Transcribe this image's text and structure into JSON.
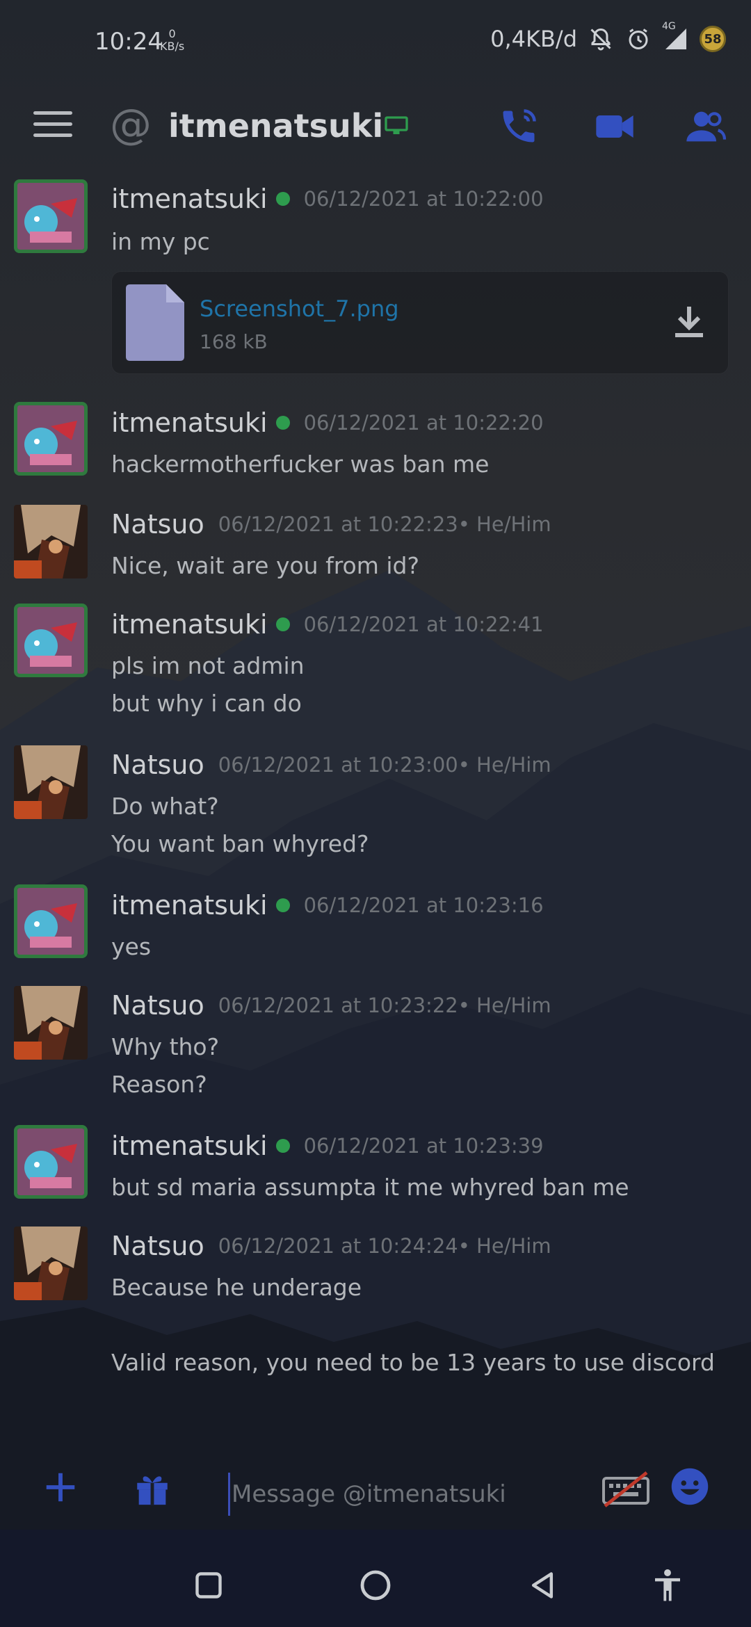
{
  "status_bar": {
    "time": "10:24",
    "net_speed_value": "0",
    "net_speed_unit": "KB/s",
    "data_usage": "0,4KB/d",
    "network_type": "4G",
    "battery_level": "58"
  },
  "header": {
    "at_symbol": "@",
    "title": "itmenatsuki",
    "accent_color": "#3350c0",
    "icons": [
      "menu-icon",
      "desktop-status-icon",
      "voice-call-icon",
      "video-call-icon",
      "members-icon"
    ]
  },
  "messages": [
    {
      "author": "itmenatsuki",
      "online": true,
      "timestamp": "06/12/2021 at 10:22:00",
      "lines": [
        "in my pc"
      ],
      "attachment": {
        "filename": "Screenshot_7.png",
        "size": "168 kB"
      }
    },
    {
      "author": "itmenatsuki",
      "online": true,
      "timestamp": "06/12/2021 at 10:22:20",
      "lines": [
        "hackermotherfucker was ban me"
      ]
    },
    {
      "author": "Natsuo",
      "timestamp": "06/12/2021 at 10:22:23",
      "pronouns": " • He/Him",
      "lines": [
        "Nice, wait are you from id?"
      ]
    },
    {
      "author": "itmenatsuki",
      "online": true,
      "timestamp": "06/12/2021 at 10:22:41",
      "lines": [
        "pls im not admin",
        "but why i can do"
      ]
    },
    {
      "author": "Natsuo",
      "timestamp": "06/12/2021 at 10:23:00",
      "pronouns": " • He/Him",
      "lines": [
        "Do what?",
        "You want ban whyred?"
      ]
    },
    {
      "author": "itmenatsuki",
      "online": true,
      "timestamp": "06/12/2021 at 10:23:16",
      "lines": [
        "yes"
      ]
    },
    {
      "author": "Natsuo",
      "timestamp": "06/12/2021 at 10:23:22",
      "pronouns": " • He/Him",
      "lines": [
        "Why tho?",
        "Reason?"
      ]
    },
    {
      "author": "itmenatsuki",
      "online": true,
      "timestamp": "06/12/2021 at 10:23:39",
      "lines": [
        "but sd maria assumpta it me whyred ban me"
      ]
    },
    {
      "author": "Natsuo",
      "timestamp": "06/12/2021 at 10:24:24",
      "pronouns": " • He/Him",
      "lines": [
        "Because he underage",
        "",
        "Valid reason, you need to be 13 years to use discord"
      ]
    }
  ],
  "composer": {
    "placeholder": "Message @itmenatsuki",
    "icons": [
      "add-icon",
      "gift-icon",
      "keyboard-disabled-icon",
      "emoji-icon"
    ]
  },
  "nav_bar": {
    "icons": [
      "recents-icon",
      "home-icon",
      "back-icon",
      "accessibility-icon"
    ]
  }
}
